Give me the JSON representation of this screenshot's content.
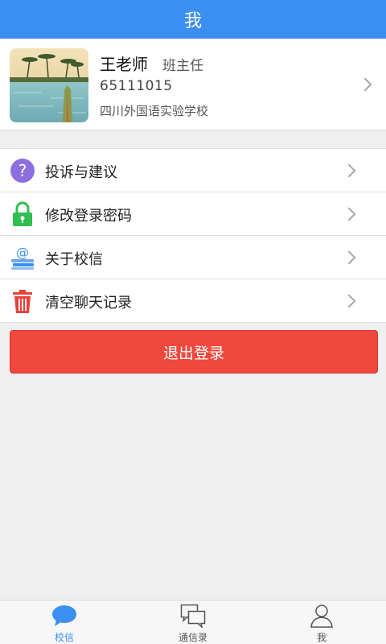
{
  "header": {
    "title": "我"
  },
  "profile": {
    "name": "王老师",
    "role": "班主任",
    "id": "65111015",
    "school": "四川外国语实验学校"
  },
  "menu": {
    "items": [
      {
        "label": "投诉与建议",
        "icon": "question-icon",
        "color": "#8e6fe0"
      },
      {
        "label": "修改登录密码",
        "icon": "lock-icon",
        "color": "#2fbf4e"
      },
      {
        "label": "关于校信",
        "icon": "at-books-icon",
        "color": "#3b8ff0"
      },
      {
        "label": "清空聊天记录",
        "icon": "trash-icon",
        "color": "#e8413a"
      }
    ]
  },
  "logout": {
    "label": "退出登录",
    "color": "#f0483d"
  },
  "tabbar": {
    "tabs": [
      {
        "label": "校信",
        "icon": "chat-bubble-icon",
        "active": true
      },
      {
        "label": "通信录",
        "icon": "contacts-icon",
        "active": false
      },
      {
        "label": "我",
        "icon": "person-icon",
        "active": false
      }
    ]
  },
  "colors": {
    "accent": "#3b8ff0",
    "background": "#efefef"
  }
}
